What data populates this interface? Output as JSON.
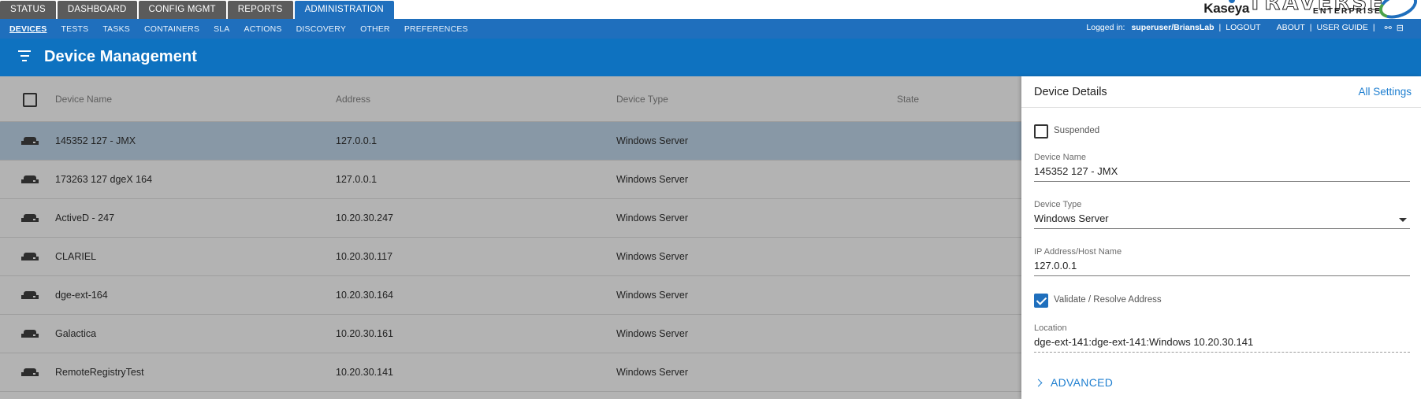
{
  "main_tabs": [
    {
      "label": "STATUS",
      "active": false
    },
    {
      "label": "DASHBOARD",
      "active": false
    },
    {
      "label": "CONFIG MGMT",
      "active": false
    },
    {
      "label": "REPORTS",
      "active": false
    },
    {
      "label": "ADMINISTRATION",
      "active": true
    }
  ],
  "brand": {
    "kaseya": "Kaseya",
    "product": "TRAVERSE",
    "edition": "ENTERPRISE"
  },
  "sub_tabs": [
    {
      "label": "DEVICES",
      "active": true
    },
    {
      "label": "TESTS",
      "active": false
    },
    {
      "label": "TASKS",
      "active": false
    },
    {
      "label": "CONTAINERS",
      "active": false
    },
    {
      "label": "SLA",
      "active": false
    },
    {
      "label": "ACTIONS",
      "active": false
    },
    {
      "label": "DISCOVERY",
      "active": false
    },
    {
      "label": "OTHER",
      "active": false
    },
    {
      "label": "PREFERENCES",
      "active": false
    }
  ],
  "userbar": {
    "logged_in_label": "Logged in:",
    "user": "superuser/BriansLab",
    "separator": "|",
    "logout": "LOGOUT",
    "about": "ABOUT",
    "user_guide": "USER GUIDE",
    "link_icon": "link-icon",
    "doc_icon": "document-icon"
  },
  "header": {
    "title": "Device Management",
    "icon": "filter-icon",
    "color": "#0e72c0"
  },
  "table": {
    "columns": [
      "Device Name",
      "Address",
      "Device Type",
      "State"
    ],
    "rows": [
      {
        "name": "145352 127 - JMX",
        "address": "127.0.0.1",
        "type": "Windows Server",
        "state": "",
        "selected": true
      },
      {
        "name": "173263 127 dgeX 164",
        "address": "127.0.0.1",
        "type": "Windows Server",
        "state": "",
        "selected": false
      },
      {
        "name": "ActiveD - 247",
        "address": "10.20.30.247",
        "type": "Windows Server",
        "state": "",
        "selected": false
      },
      {
        "name": "CLARIEL",
        "address": "10.20.30.117",
        "type": "Windows Server",
        "state": "",
        "selected": false
      },
      {
        "name": "dge-ext-164",
        "address": "10.20.30.164",
        "type": "Windows Server",
        "state": "",
        "selected": false
      },
      {
        "name": "Galactica",
        "address": "10.20.30.161",
        "type": "Windows Server",
        "state": "",
        "selected": false
      },
      {
        "name": "RemoteRegistryTest",
        "address": "10.20.30.141",
        "type": "Windows Server",
        "state": "",
        "selected": false
      }
    ]
  },
  "details": {
    "title": "Device Details",
    "all_settings": "All Settings",
    "suspended_label": "Suspended",
    "suspended": false,
    "device_name_label": "Device Name",
    "device_name": "145352 127 - JMX",
    "device_type_label": "Device Type",
    "device_type": "Windows Server",
    "ip_label": "IP Address/Host Name",
    "ip": "127.0.0.1",
    "validate_label": "Validate / Resolve Address",
    "validate": true,
    "location_label": "Location",
    "location": "dge-ext-141:dge-ext-141:Windows 10.20.30.141",
    "advanced": "ADVANCED"
  },
  "colors": {
    "accent": "#1f6fbd",
    "link": "#1f7fd0",
    "tab_dark": "#5b5b5b",
    "row_selected": "#8898a6"
  }
}
